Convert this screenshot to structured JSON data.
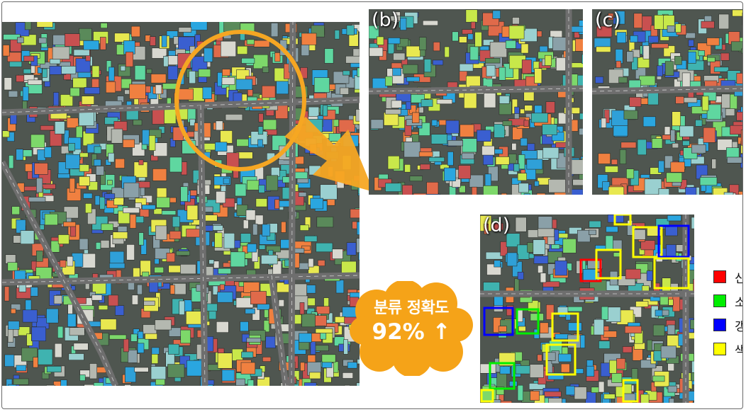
{
  "figure": {
    "panel_labels": [
      "(b)",
      "(c)",
      "(d)"
    ],
    "accuracy_label": "분류 정확도",
    "accuracy_value": "92% ↑",
    "legend": [
      {
        "label": "신",
        "color": "#ff0000"
      },
      {
        "label": "소",
        "color": "#00ee00"
      },
      {
        "label": "갱",
        "color": "#0000ff"
      },
      {
        "label": "색",
        "color": "#ffff00"
      }
    ],
    "colors": {
      "highlight_circle": "#f5a623",
      "arrow": "#f5a623",
      "cloud_fill": "#f5a318",
      "background": "#ffffff"
    }
  }
}
